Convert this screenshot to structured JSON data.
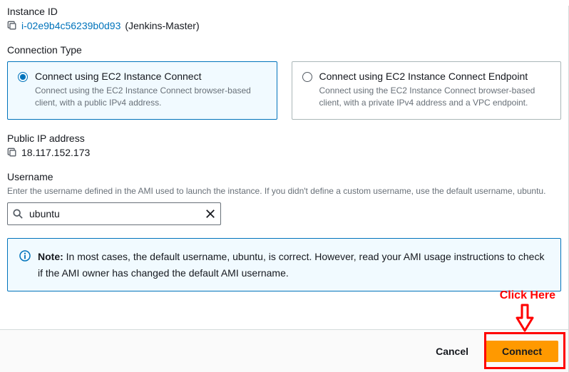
{
  "instance": {
    "label": "Instance ID",
    "id": "i-02e9b4c56239b0d93",
    "name": "(Jenkins-Master)"
  },
  "connectionType": {
    "label": "Connection Type",
    "options": [
      {
        "title": "Connect using EC2 Instance Connect",
        "desc": "Connect using the EC2 Instance Connect browser-based client, with a public IPv4 address.",
        "selected": true
      },
      {
        "title": "Connect using EC2 Instance Connect Endpoint",
        "desc": "Connect using the EC2 Instance Connect browser-based client, with a private IPv4 address and a VPC endpoint.",
        "selected": false
      }
    ]
  },
  "publicIp": {
    "label": "Public IP address",
    "value": "18.117.152.173"
  },
  "username": {
    "label": "Username",
    "desc": "Enter the username defined in the AMI used to launch the instance. If you didn't define a custom username, use the default username, ubuntu.",
    "value": "ubuntu"
  },
  "note": {
    "prefix": "Note:",
    "text": " In most cases, the default username, ubuntu, is correct. However, read your AMI usage instructions to check if the AMI owner has changed the default AMI username."
  },
  "footer": {
    "cancel": "Cancel",
    "connect": "Connect"
  },
  "annotation": {
    "text": "Click Here"
  }
}
